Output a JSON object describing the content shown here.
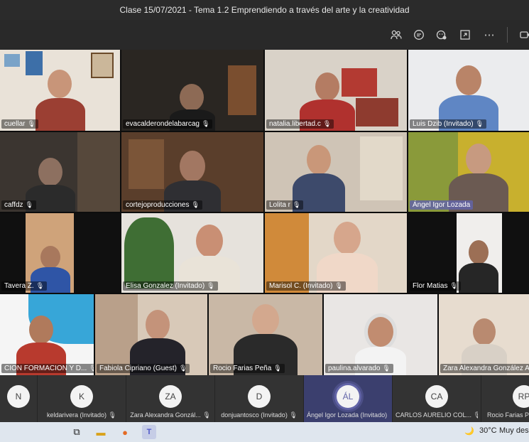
{
  "window": {
    "title": "Clase 15/07/2021 - Tema 1.2 Emprendiendo a través del arte y la creatividad"
  },
  "toolbar": {
    "icons": [
      "people-icon",
      "chat-icon",
      "reactions-icon",
      "share-screen-icon",
      "more-icon",
      "camera-icon"
    ]
  },
  "tiles": [
    {
      "name": "cuellar"
    },
    {
      "name": "evacalderondelabarcag"
    },
    {
      "name": "natalia.libertad.c"
    },
    {
      "name": "Luis Dzib (Invitado)"
    },
    {
      "name": "caffdz"
    },
    {
      "name": "cortejoproducciones"
    },
    {
      "name": "Lolita r"
    },
    {
      "name": "Ángel Igor Lozada"
    },
    {
      "name": "Tavera Z."
    },
    {
      "name": "Elisa Gonzalez (Invitado)"
    },
    {
      "name": "Marisol C. (Invitado)"
    },
    {
      "name": "Flor Matias"
    },
    {
      "name": "CION FORMACION Y D..."
    },
    {
      "name": "Fabiola Cipriano (Guest)"
    },
    {
      "name": "Rocio Farias Peña"
    },
    {
      "name": "paulina.alvarado"
    },
    {
      "name": "Zara Alexandra González Ag"
    }
  ],
  "participants_strip": [
    {
      "initials": "N",
      "name": ""
    },
    {
      "initials": "K",
      "name": "keldarivera (Invitado)"
    },
    {
      "initials": "ZA",
      "name": "Zara Alexandra Gonzál..."
    },
    {
      "initials": "D",
      "name": "donjuantosco (Invitado)"
    },
    {
      "initials": "ÁL",
      "name": "Ángel Igor Lozada (Invitado)"
    },
    {
      "initials": "CA",
      "name": "CARLOS AURELIO COL..."
    },
    {
      "initials": "RP",
      "name": "Rocio Farias Peña"
    }
  ],
  "taskbar": {
    "temperature": "30°C",
    "weather": "Muy despe"
  },
  "colors": {
    "accent": "#6264a7",
    "highlight_label": "#6264a7"
  }
}
